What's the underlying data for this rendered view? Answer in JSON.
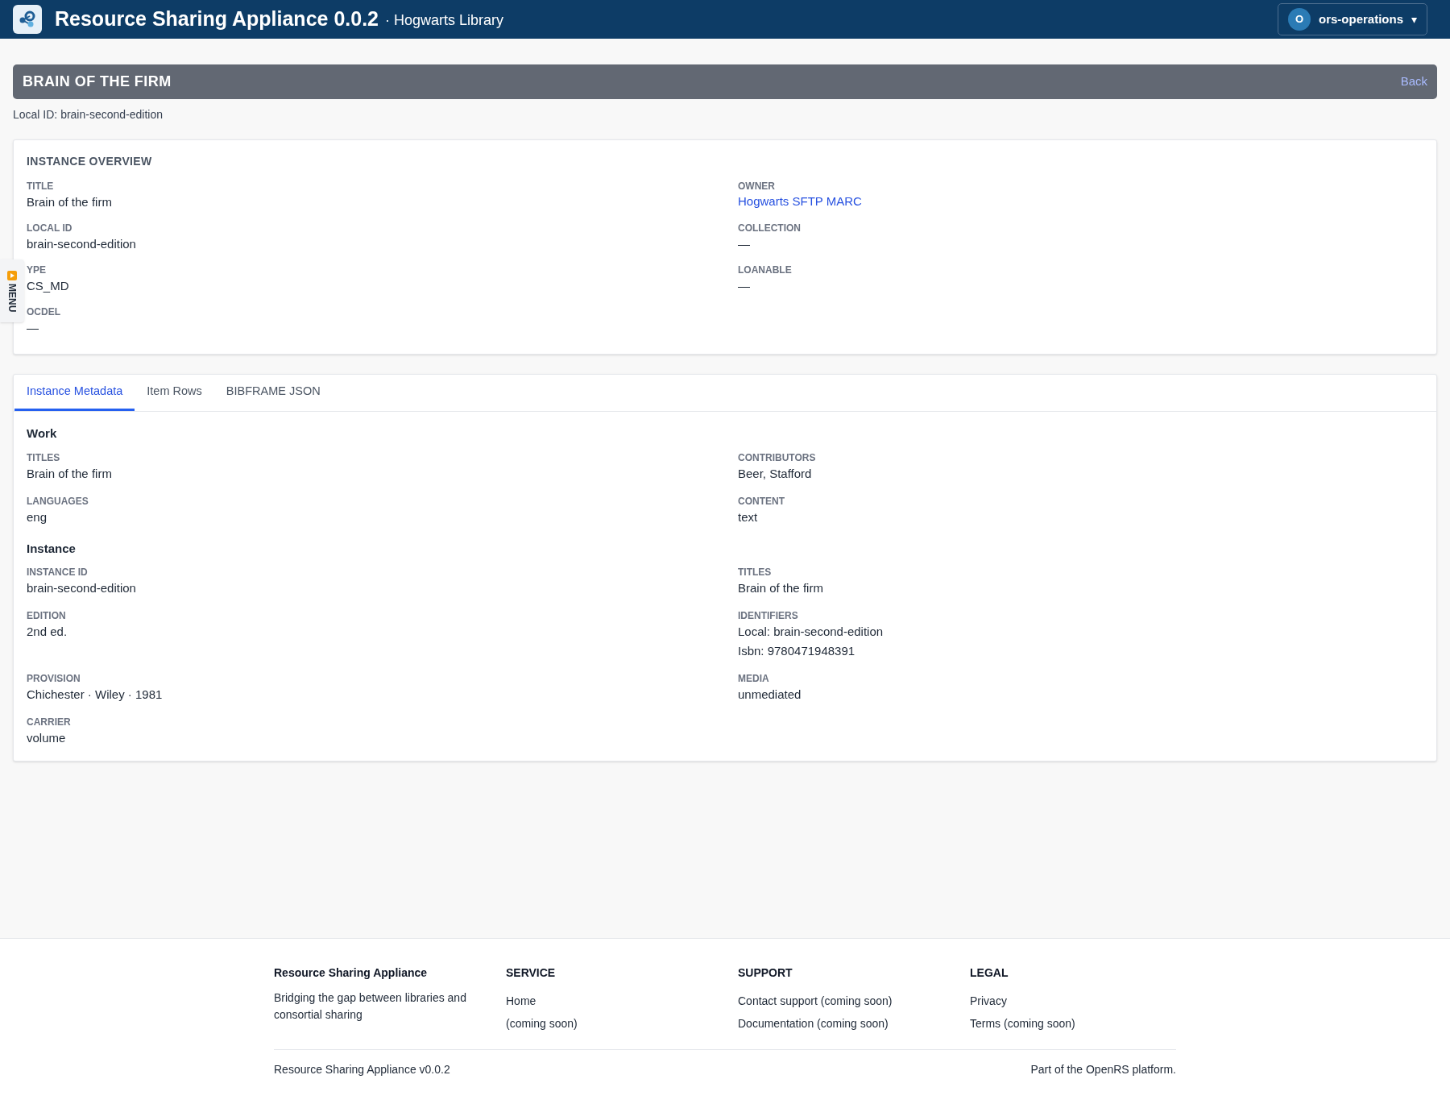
{
  "header": {
    "app_title": "Resource Sharing Appliance 0.0.2",
    "subtitle": "· Hogwarts Library",
    "user": {
      "initial": "O",
      "name": "ors-operations",
      "caret": "▾"
    }
  },
  "title_bar": {
    "title": "BRAIN OF THE FIRM",
    "back_link": "Back"
  },
  "local_id_line": "Local ID: brain-second-edition",
  "side_menu": {
    "label": "MENU"
  },
  "overview": {
    "heading": "INSTANCE OVERVIEW",
    "fields": [
      {
        "label": "TITLE",
        "values": [
          "Brain of the firm"
        ],
        "kind": "text"
      },
      {
        "label": "OWNER",
        "values": [
          "Hogwarts SFTP MARC"
        ],
        "kind": "link"
      },
      {
        "label": "LOCAL ID",
        "values": [
          "brain-second-edition"
        ],
        "kind": "text"
      },
      {
        "label": "COLLECTION",
        "values": [
          "—"
        ],
        "kind": "text"
      },
      {
        "label": "YPE",
        "values": [
          "CS_MD"
        ],
        "kind": "text"
      },
      {
        "label": "LOANABLE",
        "values": [
          "—"
        ],
        "kind": "text"
      },
      {
        "label": "OCDEL",
        "values": [
          "—"
        ],
        "kind": "text"
      }
    ]
  },
  "tabs": [
    {
      "label": "Instance Metadata",
      "selected": true
    },
    {
      "label": "Item Rows",
      "selected": false
    },
    {
      "label": "BIBFRAME JSON",
      "selected": false
    }
  ],
  "sections": [
    {
      "heading": "Work",
      "fields": [
        {
          "label": "TITLES",
          "values": [
            "Brain of the firm"
          ]
        },
        {
          "label": "CONTRIBUTORS",
          "values": [
            "Beer, Stafford"
          ]
        },
        {
          "label": "LANGUAGES",
          "values": [
            "eng"
          ]
        },
        {
          "label": "CONTENT",
          "values": [
            "text"
          ]
        }
      ]
    },
    {
      "heading": "Instance",
      "fields": [
        {
          "label": "INSTANCE ID",
          "values": [
            "brain-second-edition"
          ]
        },
        {
          "label": "TITLES",
          "values": [
            "Brain of the firm"
          ]
        },
        {
          "label": "EDITION",
          "values": [
            "2nd ed."
          ]
        },
        {
          "label": "IDENTIFIERS",
          "values": [
            "Local: brain-second-edition",
            "Isbn: 9780471948391"
          ]
        },
        {
          "label": "PROVISION",
          "values": [
            "Chichester · Wiley · 1981"
          ]
        },
        {
          "label": "MEDIA",
          "values": [
            "unmediated"
          ]
        },
        {
          "label": "CARRIER",
          "values": [
            "volume"
          ]
        }
      ]
    }
  ],
  "footer": {
    "columns": [
      {
        "heading": "Resource Sharing Appliance",
        "kind": "about",
        "items": [
          "Bridging the gap between libraries and consortial sharing"
        ]
      },
      {
        "heading": "SERVICE",
        "kind": "links",
        "items": [
          "Home",
          "(coming soon)"
        ]
      },
      {
        "heading": "SUPPORT",
        "kind": "links",
        "items": [
          "Contact support (coming soon)",
          "Documentation (coming soon)"
        ]
      },
      {
        "heading": "LEGAL",
        "kind": "links",
        "items": [
          "Privacy",
          "Terms (coming soon)"
        ]
      }
    ],
    "version": "Resource Sharing Appliance v0.0.2",
    "platform": "Part of the OpenRS platform."
  }
}
